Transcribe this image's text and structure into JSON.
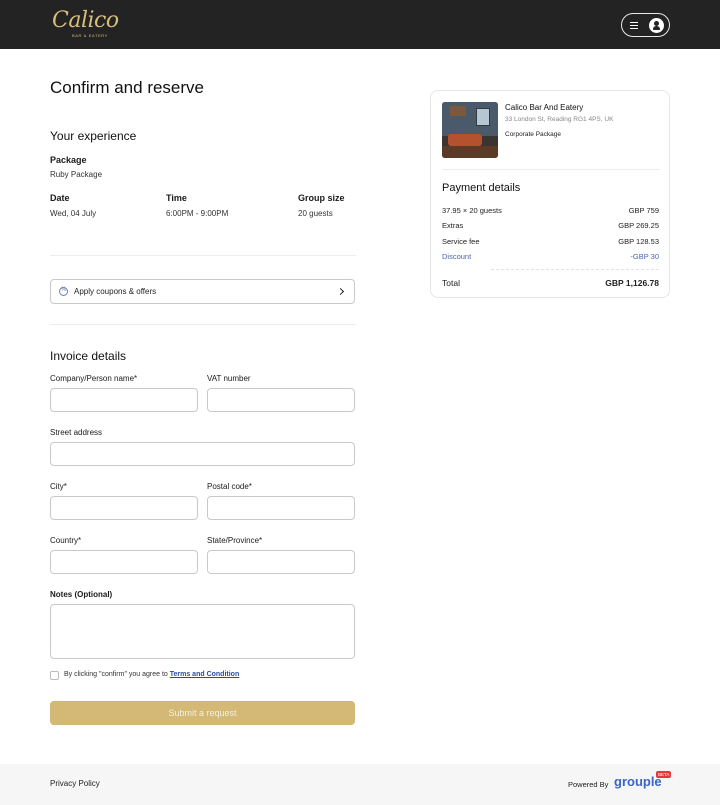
{
  "header": {
    "logo_text": "Calico",
    "logo_subtext": "BAR & EATERY",
    "menu_icon": "hamburger-menu-icon",
    "account_icon": "user-icon"
  },
  "page_title": "Confirm and reserve",
  "experience": {
    "heading": "Your experience",
    "package_label": "Package",
    "package_value": "Ruby Package",
    "date_label": "Date",
    "date_value": "Wed, 04 July",
    "time_label": "Time",
    "time_value": "6:00PM - 9:00PM",
    "group_label": "Group size",
    "group_value": "20 guests"
  },
  "coupon": {
    "label": "Apply coupons & offers",
    "icon": "discount-icon",
    "chevron_icon": "chevron-right-icon"
  },
  "invoice": {
    "heading": "Invoice details",
    "company_label": "Company/Person name*",
    "vat_label": "VAT number",
    "street_label": "Street address",
    "city_label": "City*",
    "postal_label": "Postal code*",
    "country_label": "Country*",
    "state_label": "State/Province*",
    "notes_label": "Notes (Optional)",
    "agree_prefix": "By clicking \"confirm\" you agree to ",
    "agree_link": "Terms and Condition",
    "submit_label": "Submit a request"
  },
  "venue": {
    "name": "Calico Bar And Eatery",
    "address": "33 London St, Reading RG1 4PS, UK",
    "package": "Corporate Package"
  },
  "payment": {
    "heading": "Payment details",
    "rows": [
      {
        "label": "37.95  × 20 guests",
        "amount": "GBP 759"
      },
      {
        "label": "Extras",
        "amount": "GBP 269.25"
      },
      {
        "label": "Service fee",
        "amount": "GBP 128.53"
      },
      {
        "label": "Discount",
        "amount": "-GBP 30"
      }
    ],
    "total_label": "Total",
    "total_amount": "GBP 1,126.78",
    "discount_color": "#4a63b0"
  },
  "footer": {
    "privacy": "Privacy Policy",
    "powered_by": "Powered By",
    "brand": "grouple",
    "badge": "BETA"
  },
  "colors": {
    "header_bg": "#232323",
    "accent_gold": "#d3b876",
    "link_blue": "#2b4aa0"
  }
}
